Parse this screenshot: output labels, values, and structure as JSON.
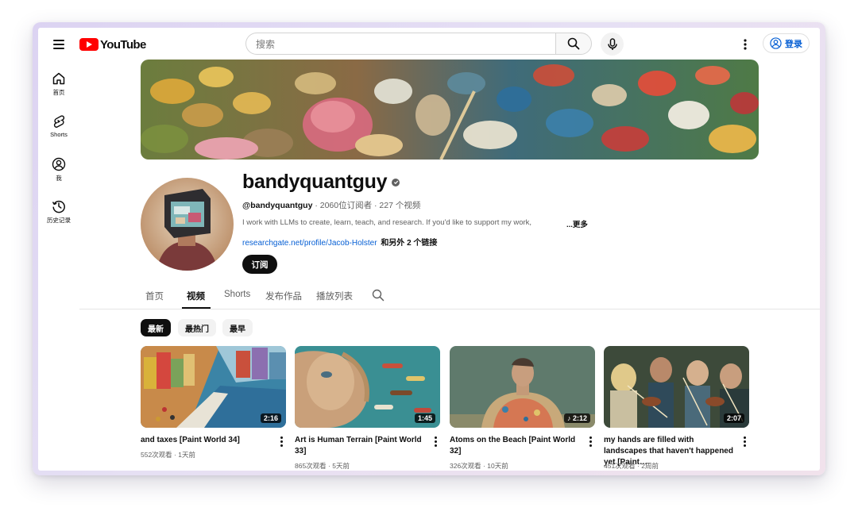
{
  "header": {
    "logo_text": "YouTube",
    "search_placeholder": "搜索",
    "login_label": "登录"
  },
  "sidebar": {
    "items": [
      {
        "label": "首页",
        "icon": "home-icon"
      },
      {
        "label": "Shorts",
        "icon": "shorts-icon"
      },
      {
        "label": "我",
        "icon": "account-icon"
      },
      {
        "label": "历史记录",
        "icon": "history-icon"
      }
    ]
  },
  "channel": {
    "name": "bandyquantguy",
    "handle": "@bandyquantguy",
    "stats": " · 2060位订阅者 · 227 个视频",
    "description": "I work with LLMs to create, learn, teach, and research. If you'd like to support my work,",
    "more_label": "...更多",
    "link": "researchgate.net/profile/Jacob-Holster",
    "link_extra": "和另外 2 个链接",
    "subscribe_label": "订阅"
  },
  "tabs": [
    {
      "label": "首页",
      "active": false
    },
    {
      "label": "视频",
      "active": true
    },
    {
      "label": "Shorts",
      "active": false
    },
    {
      "label": "发布作品",
      "active": false
    },
    {
      "label": "播放列表",
      "active": false
    }
  ],
  "chips": [
    {
      "label": "最新",
      "active": true
    },
    {
      "label": "最热门",
      "active": false
    },
    {
      "label": "最早",
      "active": false
    }
  ],
  "videos": [
    {
      "title": "and taxes [Paint World 34]",
      "duration": "2:16",
      "meta": "552次观看 · 1天前"
    },
    {
      "title": "Art is Human Terrain [Paint World 33]",
      "duration": "1:45",
      "meta": "865次观看 · 5天前"
    },
    {
      "title": "Atoms on the Beach [Paint World 32]",
      "duration": "♪ 2:12",
      "meta": "326次观看 · 10天前"
    },
    {
      "title": "my hands are filled with landscapes that haven't happened yet [Paint…",
      "duration": "2:07",
      "meta": "451次观看 · 2周前"
    }
  ],
  "colors": {
    "brand_red": "#ff0000",
    "link_blue": "#065fd4",
    "text_primary": "#0f0f0f",
    "text_secondary": "#606060"
  }
}
